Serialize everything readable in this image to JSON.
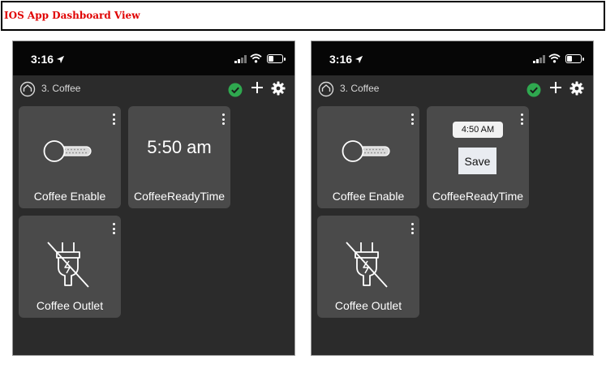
{
  "banner": {
    "title": "IOS App Dashboard View"
  },
  "screens": [
    {
      "status": {
        "time": "3:16"
      },
      "toolbar": {
        "room": "3. Coffee"
      },
      "tiles": {
        "enable": {
          "label": "Coffee Enable"
        },
        "ready_time": {
          "label": "CoffeeReadyTime",
          "display_time": "5:50 am"
        },
        "outlet": {
          "label": "Coffee Outlet"
        }
      }
    },
    {
      "status": {
        "time": "3:16"
      },
      "toolbar": {
        "room": "3. Coffee"
      },
      "tiles": {
        "enable": {
          "label": "Coffee Enable"
        },
        "ready_time": {
          "label": "CoffeeReadyTime",
          "picker_time": "4:50 AM",
          "save_label": "Save"
        },
        "outlet": {
          "label": "Coffee Outlet"
        }
      }
    }
  ],
  "colors": {
    "background": "#2b2b2b",
    "tile": "#4a4a4a",
    "check": "#2fa84f",
    "banner_text": "#e00000"
  },
  "icons": [
    "location-arrow-icon",
    "signal-icon",
    "wifi-icon",
    "battery-icon",
    "home-icon",
    "check-circle-icon",
    "plus-icon",
    "gear-icon",
    "kebab-menu-icon",
    "toggle-switch-icon",
    "unplugged-outlet-icon"
  ]
}
